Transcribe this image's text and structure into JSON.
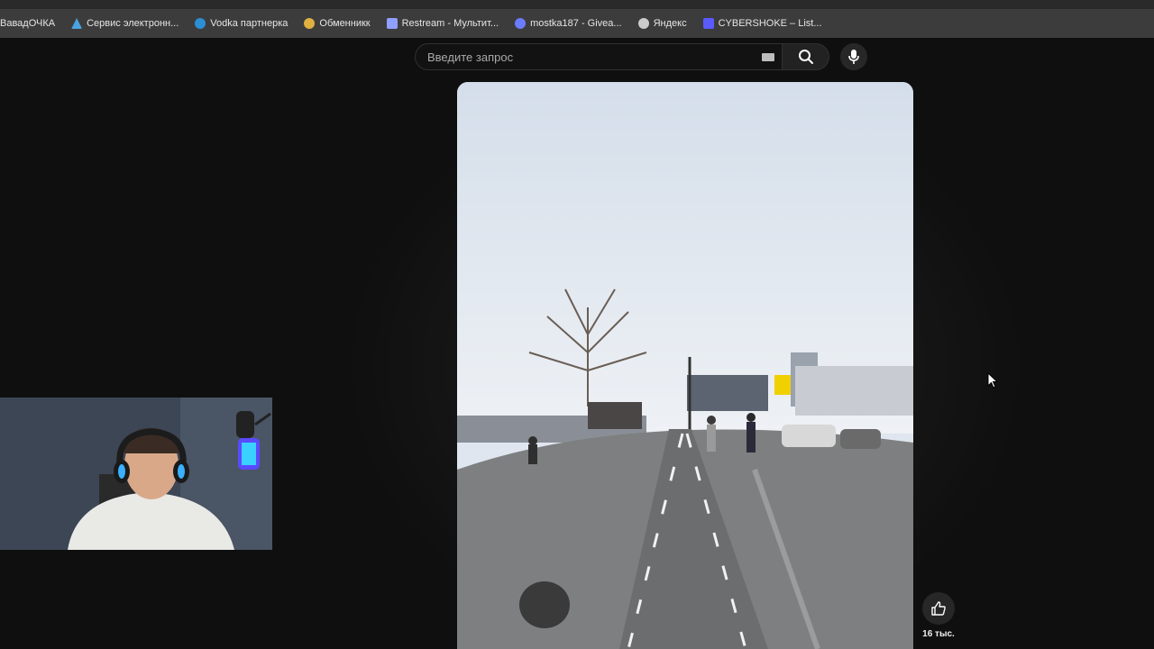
{
  "bookmarks": [
    {
      "label": "ВавадОЧКА",
      "icon": "none",
      "color": ""
    },
    {
      "label": "Сервис электронн...",
      "icon": "triangle-icon",
      "color": "#4aa3df"
    },
    {
      "label": "Vodka партнерка",
      "icon": "bird-icon",
      "color": "#2b8fd6"
    },
    {
      "label": "Обменникк",
      "icon": "exchange-icon",
      "color": "#e0b040"
    },
    {
      "label": "Restream - Мультит...",
      "icon": "restream-icon",
      "color": "#8fa0ff"
    },
    {
      "label": "mostka187 - Givea...",
      "icon": "globe-icon",
      "color": "#6b7cff"
    },
    {
      "label": "Яндекс",
      "icon": "globe-icon",
      "color": "#cccccc"
    },
    {
      "label": "CYBERSHOKE – List...",
      "icon": "shield-icon",
      "color": "#5a5aff"
    }
  ],
  "search": {
    "placeholder": "Введите запрос"
  },
  "video": {
    "likes": "16 тыс."
  },
  "colors": {
    "background": "#0f0f0f",
    "bookmark_bar": "#3c3c3c",
    "search_bg": "#121212"
  }
}
